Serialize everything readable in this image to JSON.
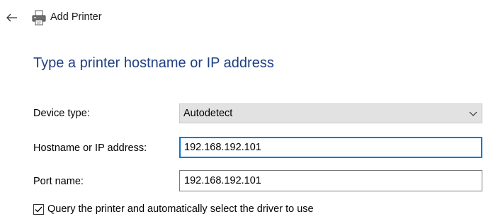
{
  "window": {
    "title": "Add Printer",
    "back_icon": "back-arrow-icon",
    "title_icon": "printer-icon"
  },
  "heading": "Type a printer hostname or IP address",
  "form": {
    "device_type": {
      "label": "Device type:",
      "value": "Autodetect"
    },
    "hostname": {
      "label": "Hostname or IP address:",
      "value": "192.168.192.101"
    },
    "port_name": {
      "label": "Port name:",
      "value": "192.168.192.101"
    },
    "query_printer": {
      "label": "Query the printer and automatically select the driver to use",
      "checked": true
    }
  },
  "colors": {
    "heading": "#1f3f83",
    "focus_border": "#0078d7",
    "select_bg": "#e2e2e2"
  }
}
